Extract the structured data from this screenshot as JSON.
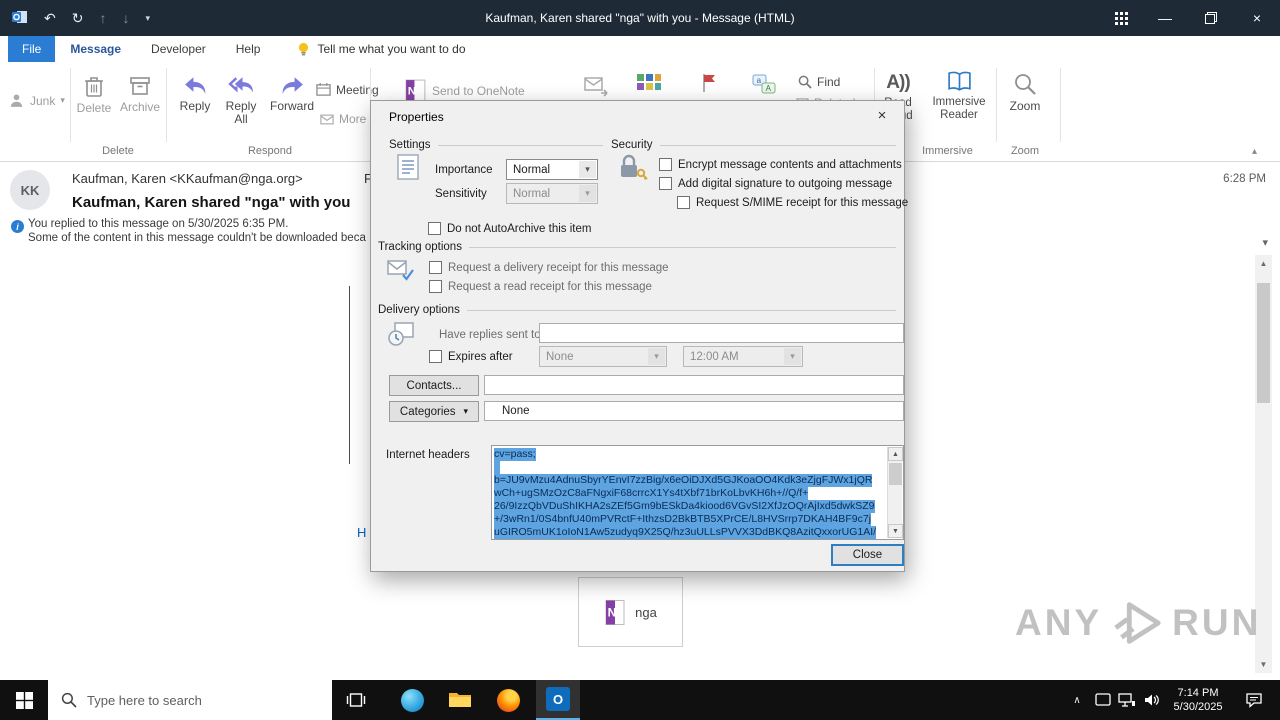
{
  "colors": {
    "titlebar_bg": "#1f2a37",
    "file_tab_blue": "#2b7cd3",
    "active_tab_text": "#2b579a",
    "selection_bg": "#5da4e0",
    "selection_text": "#0b2c55",
    "link_blue": "#0563c1",
    "onenote_purple": "#8440a5",
    "flag_red": "#c94747",
    "taskbar_bg": "#101010",
    "dialog_bg": "#f0f0f0",
    "focus_border": "#2e7fc2"
  },
  "icons": {
    "undo": "↶",
    "sync": "↻",
    "previous": "↑",
    "next": "↓",
    "dropdown": "▾",
    "minimize": "—",
    "close": "×",
    "scroll_up": "▲",
    "scroll_down": "▼",
    "collapse_ribbon": "▴",
    "expand_infobar": "▾",
    "tray_chevron": "∧",
    "info": "i"
  },
  "titlebar": {
    "title": "Kaufman, Karen shared \"nga\" with you  -  Message (HTML)"
  },
  "tabs": {
    "file": "File",
    "message": "Message",
    "developer": "Developer",
    "help": "Help",
    "tell_me": "Tell me what you want to do"
  },
  "ribbon": {
    "junk": "Junk",
    "delete": "Delete",
    "archive": "Archive",
    "reply": "Reply",
    "reply_all": "Reply All",
    "forward": "Forward",
    "meeting": "Meeting",
    "more": "More",
    "send_to_onenote": "Send to OneNote",
    "find": "Find",
    "related": "Related",
    "read_aloud": "Read Aloud",
    "immersive_reader": "Immersive Reader",
    "zoom": "Zoom",
    "groups": {
      "delete": "Delete",
      "respond": "Respond",
      "immersive": "Immersive",
      "zoom": "Zoom"
    }
  },
  "message": {
    "avatar": "KK",
    "from": "Kaufman, Karen <KKaufman@nga.org>",
    "header_fragment": "F",
    "time": "6:28 PM",
    "subject": "Kaufman, Karen shared \"nga\" with you",
    "info_line1": "You replied to this message on 5/30/2025 6:35 PM.",
    "info_line2": "Some of the content in this message couldn't be downloaded beca",
    "body_link_fragment": "H",
    "attachment_name": "nga"
  },
  "dialog": {
    "title": "Properties",
    "settings": {
      "legend": "Settings",
      "importance_label": "Importance",
      "importance_value": "Normal",
      "sensitivity_label": "Sensitivity",
      "sensitivity_value": "Normal",
      "autoarchive_label": "Do not AutoArchive this item"
    },
    "security": {
      "legend": "Security",
      "encrypt": "Encrypt message contents and attachments",
      "sign": "Add digital signature to outgoing message",
      "receipt": "Request S/MIME receipt for this message"
    },
    "tracking": {
      "legend": "Tracking options",
      "delivery_receipt": "Request a delivery receipt for this message",
      "read_receipt": "Request a read receipt for this message"
    },
    "delivery": {
      "legend": "Delivery options",
      "replies_label": "Have replies sent to",
      "expires_label": "Expires after",
      "expires_value": "None",
      "expires_time": "12:00 AM"
    },
    "contacts_button": "Contacts...",
    "categories_button": "Categories",
    "categories_value": "None",
    "headers_label": "Internet headers",
    "headers_lines": [
      "cv=pass;",
      "",
      "b=JU9vMzu4AdnuSbyrYEnvI7zzBig/x6eOiDJXd5GJKoaOO4Kdk3eZjgFJWx1jQR",
      "wCh+ugSMzOzC8aFNgxiF68crrcX1Ys4tXbf71brKoLbvKH6h+//Q/f+",
      "26/9IzzQbVDuShIKHA2sZEf5Gm9bESkDa4kiood6VGvSI2XfJzOQrAjIxd5dwkSZ9",
      "+/3wRn1/0S4bnfU40mPVRctF+IthzsD2BkBTB5XPrCE/L8HVSrrp7DKAH4BF9c7j",
      "uGIRO5mUK1oIoN1Aw5zudyq9X25Q/hz3uULLsPVVX3DdBKQ8AzitQxxorUG1AI/"
    ],
    "close_button": "Close"
  },
  "taskbar": {
    "search_placeholder": "Type here to search",
    "time": "7:14 PM",
    "date": "5/30/2025"
  },
  "watermark": {
    "any": "ANY",
    "run": "RUN"
  }
}
